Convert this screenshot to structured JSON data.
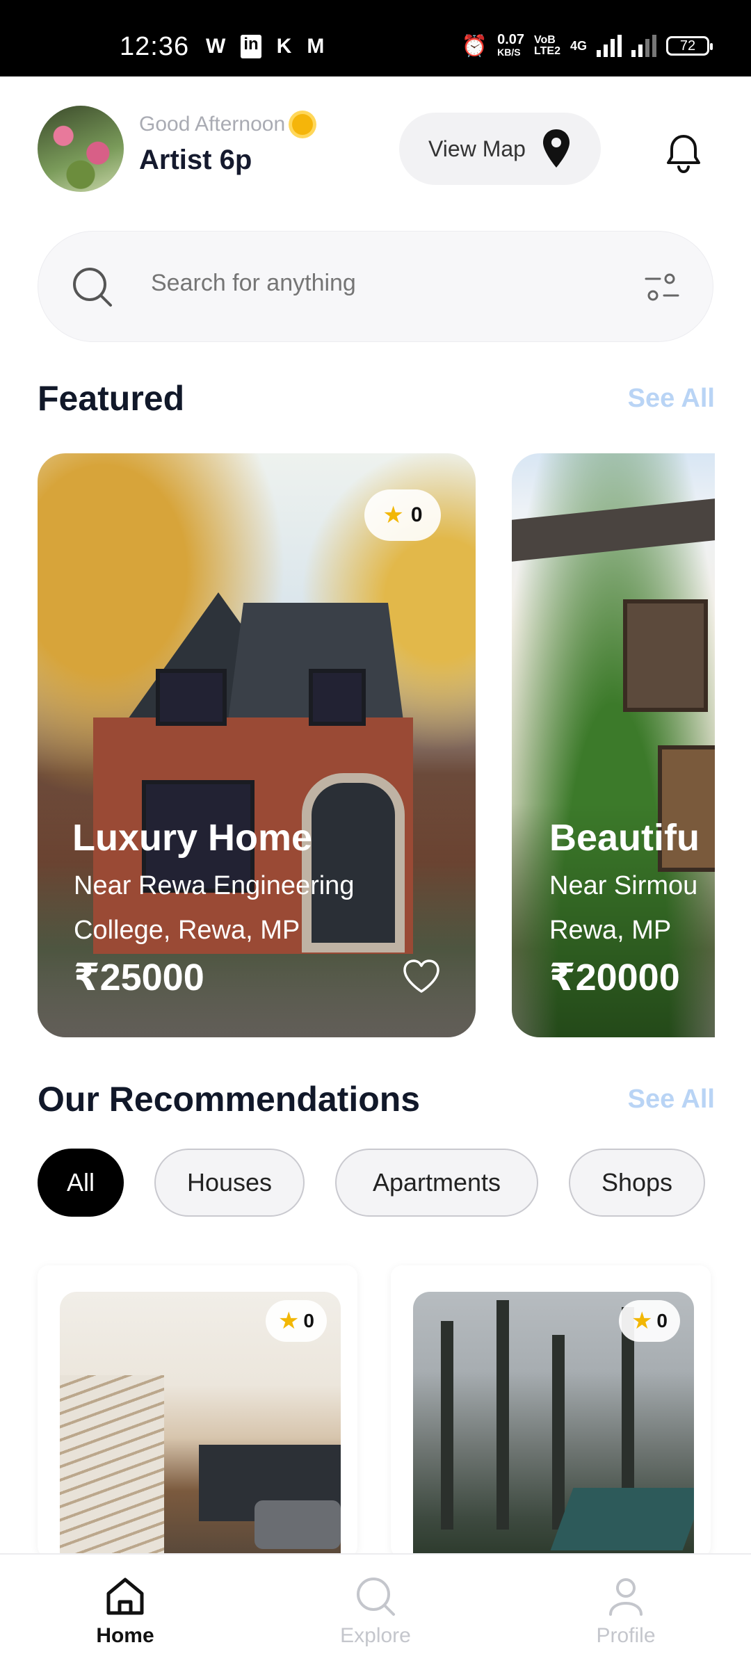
{
  "status_bar": {
    "time": "12:36",
    "left_icons": [
      "W",
      "in",
      "K",
      "M"
    ],
    "speed_top": "0.07",
    "speed_bottom": "KB/S",
    "net_top": "VoB",
    "net_bottom": "LTE2",
    "network_type": "4G",
    "battery": "72"
  },
  "header": {
    "greeting": "Good Afternoon",
    "username": "Artist 6p",
    "view_map_label": "View Map"
  },
  "search": {
    "placeholder": "Search for anything"
  },
  "featured": {
    "title": "Featured",
    "see_all": "See All",
    "cards": [
      {
        "title": "Luxury Home",
        "location": "Near Rewa Engineering College, Rewa, MP",
        "price": "₹25000",
        "rating": "0"
      },
      {
        "title": "Beautifu",
        "location": "Near Sirmou Rewa, MP",
        "price": "₹20000",
        "rating": "0"
      }
    ]
  },
  "recommendations": {
    "title": "Our Recommendations",
    "see_all": "See All",
    "chips": [
      "All",
      "Houses",
      "Apartments",
      "Shops"
    ],
    "cards": [
      {
        "rating": "0"
      },
      {
        "rating": "0"
      }
    ]
  },
  "bottom_nav": {
    "items": [
      {
        "label": "Home",
        "icon": "home-icon",
        "active": true
      },
      {
        "label": "Explore",
        "icon": "search-icon",
        "active": false
      },
      {
        "label": "Profile",
        "icon": "user-icon",
        "active": false
      }
    ]
  },
  "colors": {
    "accent_link": "#b9d4f5",
    "title_dark": "#111829",
    "chip_active": "#000000",
    "star": "#f2b705"
  }
}
